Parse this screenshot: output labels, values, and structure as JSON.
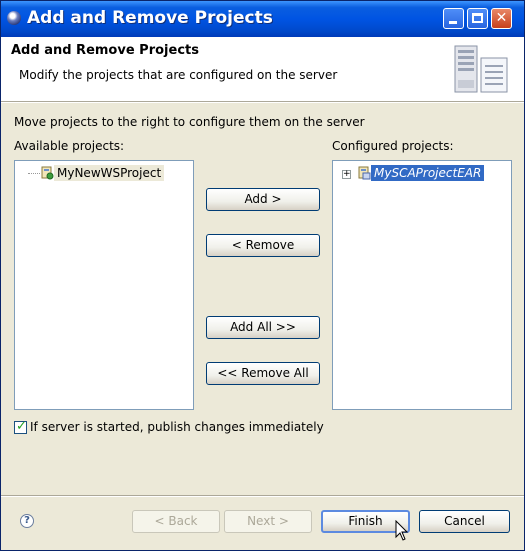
{
  "window": {
    "title": "Add and Remove Projects"
  },
  "header": {
    "title": "Add and Remove Projects",
    "description": "Modify the projects that are configured on the server"
  },
  "instructions": "Move projects to the right to configure them on the server",
  "available": {
    "label": "Available projects:",
    "items": [
      {
        "label": "MyNewWSProject"
      }
    ]
  },
  "configured": {
    "label": "Configured projects:",
    "items": [
      {
        "label": "MySCAProjectEAR",
        "expander": "+"
      }
    ]
  },
  "actions": {
    "add": "Add >",
    "remove": "< Remove",
    "add_all": "Add All >>",
    "remove_all": "<< Remove All"
  },
  "publish_checkbox": {
    "label": "If server is started, publish changes immediately",
    "checked": true
  },
  "footer": {
    "help": "?",
    "back": "< Back",
    "next": "Next >",
    "finish": "Finish",
    "cancel": "Cancel"
  },
  "icons": {
    "app": "eclipse-icon",
    "banner": "server-banner-icon",
    "project": "project-icon",
    "pointer": "mouse-pointer-icon"
  },
  "colors": {
    "titlebar": "#0054e3",
    "selection": "#316ac5",
    "dialog": "#ece9d8"
  }
}
